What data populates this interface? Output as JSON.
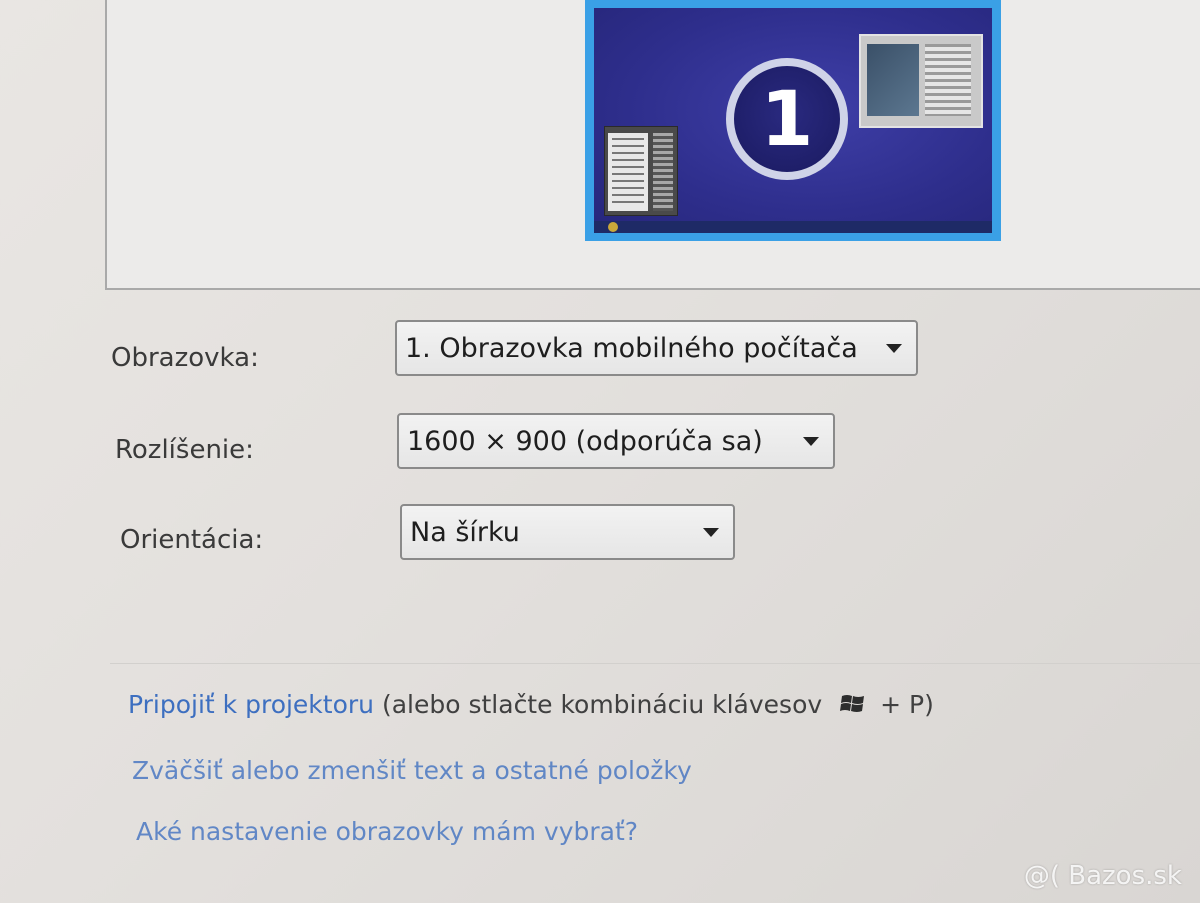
{
  "preview": {
    "monitor_number": "1"
  },
  "form": {
    "display": {
      "label": "Obrazovka:",
      "value": "1. Obrazovka mobilného počítača"
    },
    "resolution": {
      "label": "Rozlíšenie:",
      "value": "1600 × 900 (odporúča sa)"
    },
    "orientation": {
      "label": "Orientácia:",
      "value": "Na šírku"
    }
  },
  "links": {
    "projector": {
      "link_text": "Pripojiť k projektoru",
      "rest_text": " (alebo stlačte kombináciu klávesov",
      "key_suffix": "+ P)"
    },
    "text_size": {
      "link_text": "Zväčšiť alebo zmenšiť text a ostatné položky"
    },
    "help": {
      "link_text": "Aké nastavenie obrazovky mám vybrať?"
    }
  },
  "watermark": "@( Bazos.sk",
  "colors": {
    "link": "#3d6fc0",
    "monitor_border": "#3aa0e6",
    "desktop": "#2e2e8c"
  },
  "icons": {
    "arrow": "chevron-down-icon",
    "windows_key": "windows-logo-icon"
  }
}
